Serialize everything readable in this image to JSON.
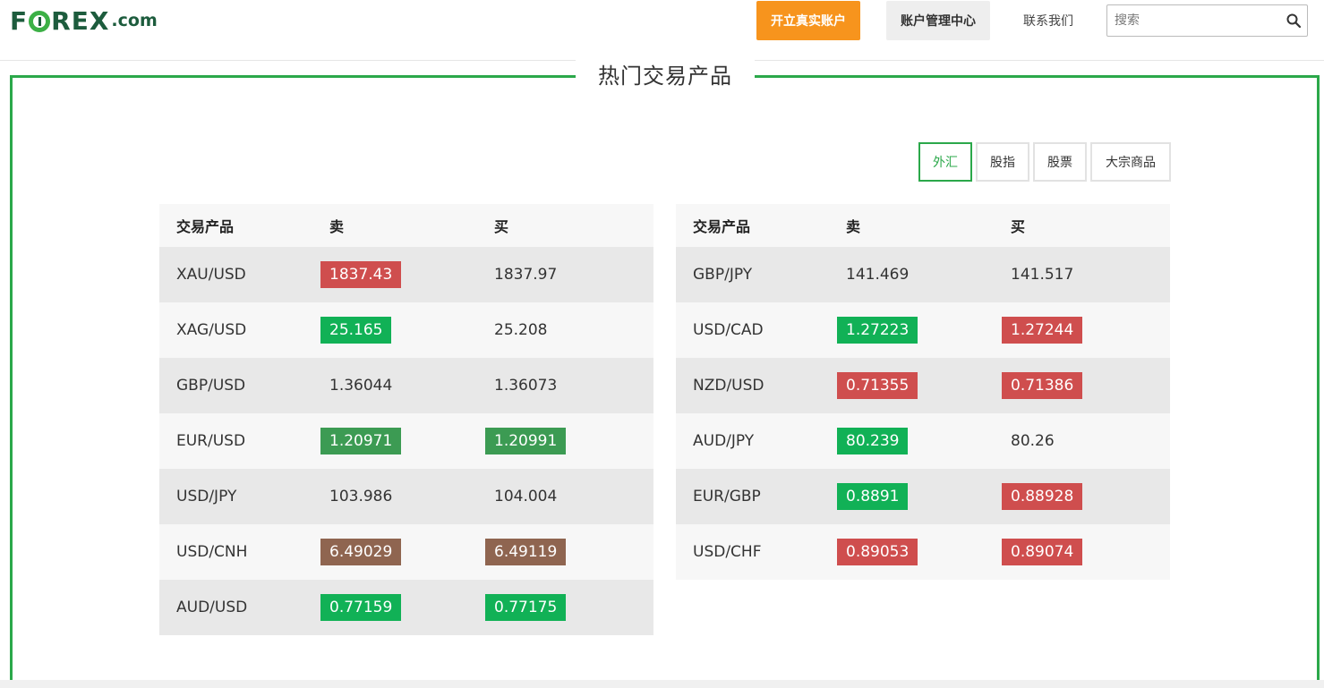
{
  "header": {
    "logo_left": "F",
    "logo_right": "REX",
    "logo_suffix": ".com",
    "open_account_label": "开立真实账户",
    "account_center_label": "账户管理中心",
    "contact_label": "联系我们",
    "search_placeholder": "搜索"
  },
  "section": {
    "title": "热门交易产品",
    "tabs": [
      {
        "label": "外汇",
        "active": true
      },
      {
        "label": "股指",
        "active": false
      },
      {
        "label": "股票",
        "active": false
      },
      {
        "label": "大宗商品",
        "active": false
      }
    ]
  },
  "tables": [
    {
      "headers": {
        "product": "交易产品",
        "sell": "卖",
        "buy": "买"
      },
      "rows": [
        {
          "product": "XAU/USD",
          "sell": "1837.43",
          "sell_state": "red",
          "buy": "1837.97",
          "buy_state": "none"
        },
        {
          "product": "XAG/USD",
          "sell": "25.165",
          "sell_state": "green",
          "buy": "25.208",
          "buy_state": "none"
        },
        {
          "product": "GBP/USD",
          "sell": "1.36044",
          "sell_state": "none",
          "buy": "1.36073",
          "buy_state": "none"
        },
        {
          "product": "EUR/USD",
          "sell": "1.20971",
          "sell_state": "dgreen",
          "buy": "1.20991",
          "buy_state": "dgreen"
        },
        {
          "product": "USD/JPY",
          "sell": "103.986",
          "sell_state": "none",
          "buy": "104.004",
          "buy_state": "none"
        },
        {
          "product": "USD/CNH",
          "sell": "6.49029",
          "sell_state": "brown",
          "buy": "6.49119",
          "buy_state": "brown"
        },
        {
          "product": "AUD/USD",
          "sell": "0.77159",
          "sell_state": "green",
          "buy": "0.77175",
          "buy_state": "green"
        }
      ]
    },
    {
      "headers": {
        "product": "交易产品",
        "sell": "卖",
        "buy": "买"
      },
      "rows": [
        {
          "product": "GBP/JPY",
          "sell": "141.469",
          "sell_state": "none",
          "buy": "141.517",
          "buy_state": "none"
        },
        {
          "product": "USD/CAD",
          "sell": "1.27223",
          "sell_state": "green",
          "buy": "1.27244",
          "buy_state": "red"
        },
        {
          "product": "NZD/USD",
          "sell": "0.71355",
          "sell_state": "red",
          "buy": "0.71386",
          "buy_state": "red"
        },
        {
          "product": "AUD/JPY",
          "sell": "80.239",
          "sell_state": "green",
          "buy": "80.26",
          "buy_state": "none"
        },
        {
          "product": "EUR/GBP",
          "sell": "0.8891",
          "sell_state": "green",
          "buy": "0.88928",
          "buy_state": "red"
        },
        {
          "product": "USD/CHF",
          "sell": "0.89053",
          "sell_state": "red",
          "buy": "0.89074",
          "buy_state": "red"
        }
      ]
    }
  ],
  "colors": {
    "accent_green": "#2ba84a",
    "orange": "#f7941d",
    "tick_red": "#cf4e4e",
    "tick_green": "#11b156",
    "tick_dark_green": "#3c9b53",
    "tick_brown": "#8f6550"
  }
}
